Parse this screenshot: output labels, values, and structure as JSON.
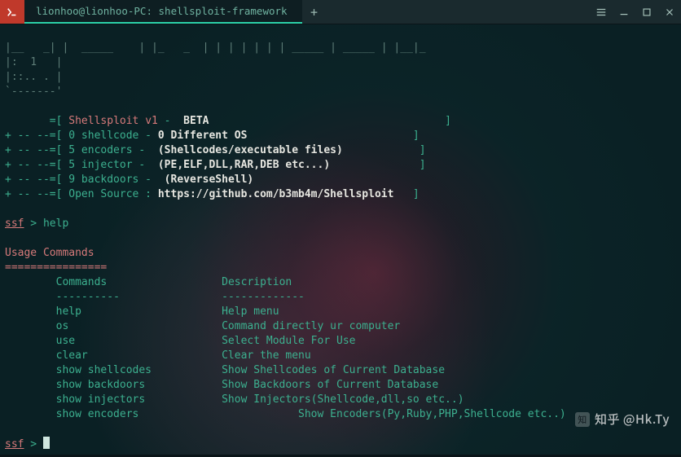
{
  "window": {
    "tab_title": "lionhoo@lionhoo-PC: shellsploit-framework"
  },
  "ascii": {
    "l1": "|__   _| |  _____    | |_   _  | | | | | | | _____ | _____ | |__|_",
    "l2": "|:  1   |",
    "l3": "|::.. . |",
    "l4": "`-------'"
  },
  "banner": {
    "prefix_app": "       =[ ",
    "app": "Shellsploit v1",
    "dash": " -  ",
    "beta": "BETA",
    "beta_pad": "                                     ",
    "close": "]",
    "row2_pref": "+ -- --=[ 0 shellcode - ",
    "row2_white": "0 Different OS",
    "row2_pad": "                          ",
    "row3_pref": "+ -- --=[ 5 encoders -  ",
    "row3_white": "(Shellcodes/executable files)",
    "row3_pad": "            ",
    "row4_pref": "+ -- --=[ 5 injector -  ",
    "row4_white": "(PE,ELF,DLL,RAR,DEB etc...)",
    "row4_pad": "              ",
    "row5_pref": "+ -- --=[ 9 backdoors -  ",
    "row5_white": "(ReverseShell)",
    "row6_pref": "+ -- --=[ Open Source : ",
    "row6_url": "https://github.com/b3mb4m/Shellsploit",
    "row6_pad": "   "
  },
  "prompt": {
    "name": "ssf",
    "sep": " > ",
    "cmd": "help"
  },
  "usage": {
    "title": "Usage Commands",
    "rule": "================",
    "hdr_cmd": "Commands",
    "hdr_desc": "Description",
    "dash_cmd": "----------",
    "dash_desc": "-------------",
    "rows": [
      {
        "cmd": "help",
        "desc": "Help menu"
      },
      {
        "cmd": "os",
        "desc": "Command directly ur computer"
      },
      {
        "cmd": "use",
        "desc": "Select Module For Use"
      },
      {
        "cmd": "clear",
        "desc": "Clear the menu"
      },
      {
        "cmd": "show shellcodes",
        "desc": "Show Shellcodes of Current Database"
      },
      {
        "cmd": "show backdoors",
        "desc": "Show Backdoors of Current Database"
      },
      {
        "cmd": "show injectors",
        "desc": "Show Injectors(Shellcode,dll,so etc..)"
      },
      {
        "cmd": "show encoders",
        "desc": "Show Encoders(Py,Ruby,PHP,Shellcode etc..)"
      }
    ]
  },
  "watermark": {
    "text": "知乎 @Hk.Ty"
  }
}
